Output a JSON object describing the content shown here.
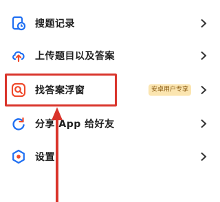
{
  "menu": {
    "items": [
      {
        "label": "搜题记录",
        "icon": "search-history-icon"
      },
      {
        "label": "上传题目以及答案",
        "icon": "upload-cloud-icon"
      },
      {
        "label": "找答案浮窗",
        "icon": "floating-search-icon",
        "badge": "安卓用户专享"
      },
      {
        "label": "分享 App 给好友",
        "icon": "share-refresh-icon"
      },
      {
        "label": "设置",
        "icon": "settings-gear-icon"
      }
    ]
  },
  "colors": {
    "accent": "#1f6ff2",
    "highlight_red": "#d9342b",
    "badge_bg": "#fbe5b0",
    "badge_text": "#8a5a12"
  }
}
